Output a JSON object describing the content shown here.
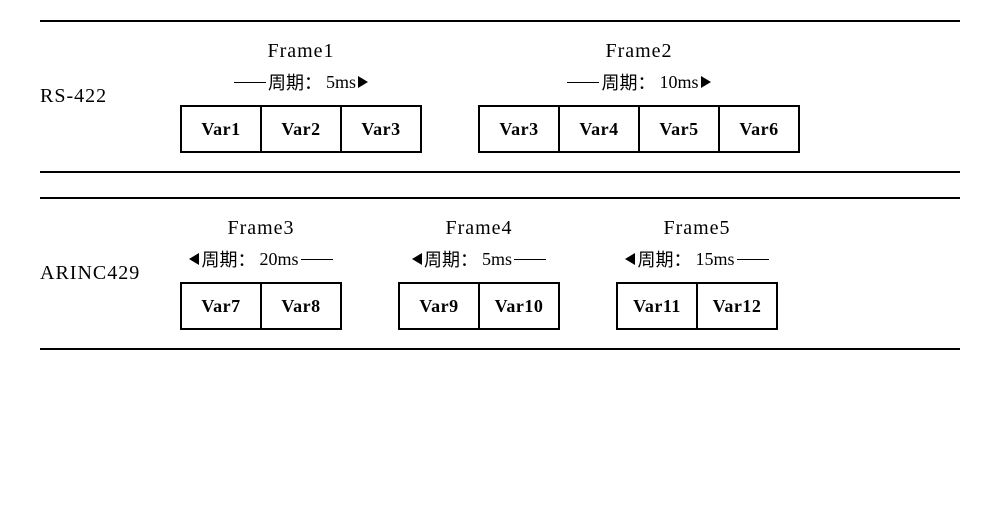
{
  "rows": [
    {
      "protocol": "RS-422",
      "frames": [
        {
          "title": "Frame1",
          "period_prefix": "周期：",
          "period_value": "5ms",
          "arrow_dir": "right",
          "vars": [
            "Var1",
            "Var2",
            "Var3"
          ]
        },
        {
          "title": "Frame2",
          "period_prefix": "周期：",
          "period_value": "10ms",
          "arrow_dir": "right",
          "vars": [
            "Var3",
            "Var4",
            "Var5",
            "Var6"
          ]
        }
      ]
    },
    {
      "protocol": "ARINC429",
      "frames": [
        {
          "title": "Frame3",
          "period_prefix": "周期：",
          "period_value": "20ms",
          "arrow_dir": "left",
          "vars": [
            "Var7",
            "Var8"
          ]
        },
        {
          "title": "Frame4",
          "period_prefix": "周期：",
          "period_value": "5ms",
          "arrow_dir": "left",
          "vars": [
            "Var9",
            "Var10"
          ]
        },
        {
          "title": "Frame5",
          "period_prefix": "周期：",
          "period_value": "15ms",
          "arrow_dir": "left",
          "vars": [
            "Var11",
            "Var12"
          ]
        }
      ]
    }
  ]
}
